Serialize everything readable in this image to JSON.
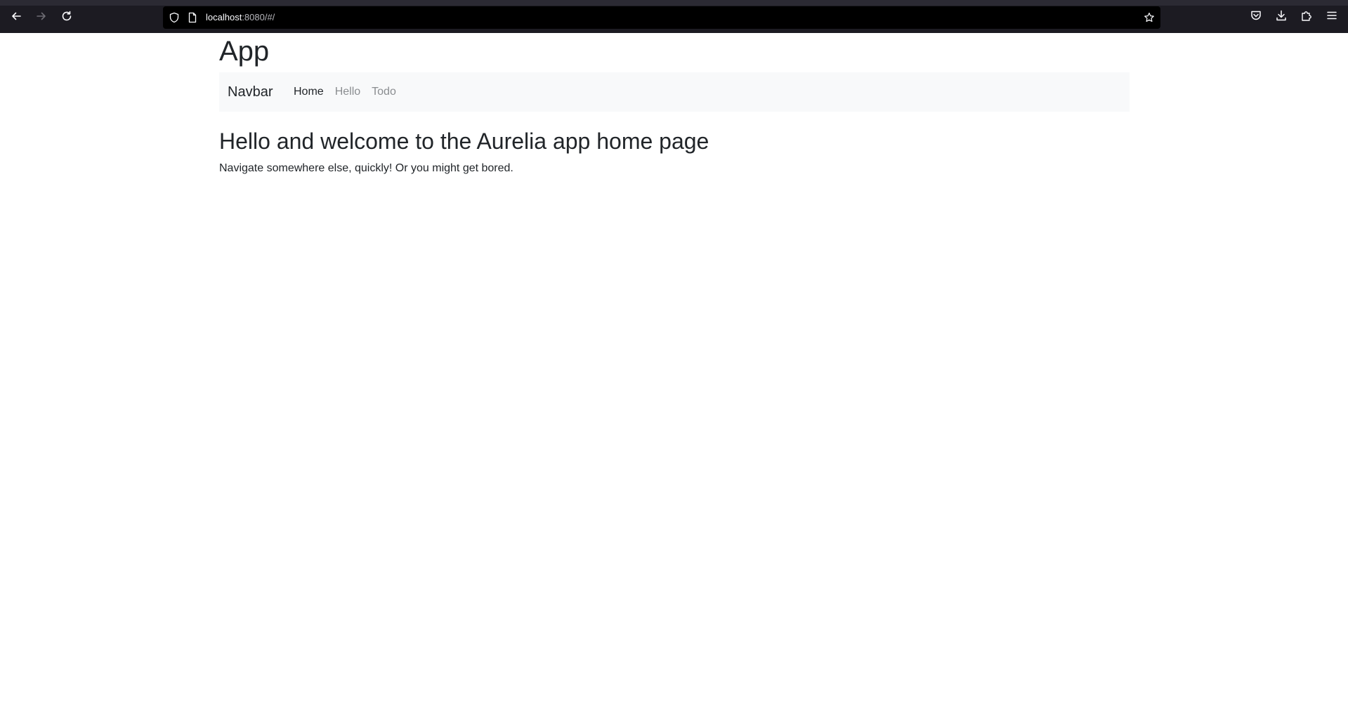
{
  "browser": {
    "url_host": "localhost",
    "url_rest": ":8080/#/",
    "icons": {
      "back": "arrow-left-icon",
      "forward": "arrow-right-icon",
      "reload": "reload-icon",
      "tracking": "shield-icon",
      "page": "page-icon",
      "bookmark": "star-icon",
      "pocket": "pocket-icon",
      "downloads": "download-icon",
      "extensions": "puzzle-icon",
      "menu": "hamburger-menu-icon"
    },
    "colors": {
      "chrome": "#1c1b22",
      "urlbar": "#000000"
    }
  },
  "app": {
    "title": "App",
    "navbar": {
      "brand": "Navbar",
      "links": [
        {
          "label": "Home",
          "active": true
        },
        {
          "label": "Hello",
          "active": false
        },
        {
          "label": "Todo",
          "active": false
        }
      ],
      "background": "#f8f9fa"
    },
    "home": {
      "heading": "Hello and welcome to the Aurelia app home page",
      "text": "Navigate somewhere else, quickly! Or you might get bored."
    }
  }
}
